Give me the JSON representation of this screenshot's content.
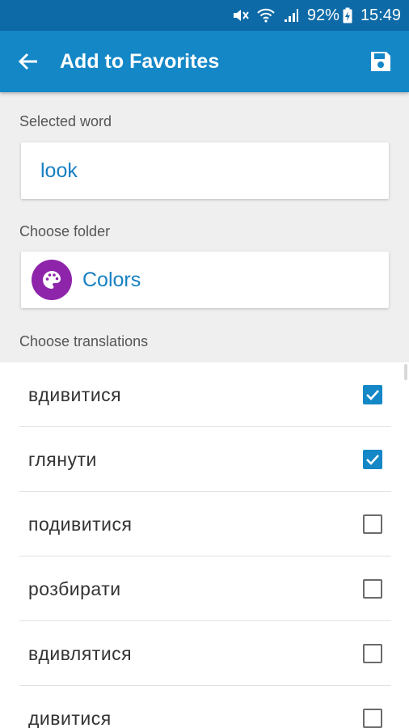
{
  "status_bar": {
    "battery": "92%",
    "time": "15:49",
    "icons": [
      "mute-icon",
      "wifi-icon",
      "signal-icon",
      "battery-charging-icon"
    ]
  },
  "app_bar": {
    "title": "Add to Favorites",
    "back_icon": "arrow-left-icon",
    "save_icon": "save-icon"
  },
  "selected_word": {
    "label": "Selected word",
    "value": "look"
  },
  "folder": {
    "label": "Choose folder",
    "name": "Colors",
    "icon": "palette-icon",
    "icon_color": "#8e24aa"
  },
  "translations": {
    "label": "Choose translations",
    "items": [
      {
        "text": "вдивитися",
        "checked": true
      },
      {
        "text": "глянути",
        "checked": true
      },
      {
        "text": "подивитися",
        "checked": false
      },
      {
        "text": "розбирати",
        "checked": false
      },
      {
        "text": "вдивлятися",
        "checked": false
      },
      {
        "text": "дивитися",
        "checked": false
      }
    ]
  },
  "colors": {
    "accent": "#1487c7",
    "status_bar": "#0d6aa6",
    "link_text": "#1780c2"
  }
}
